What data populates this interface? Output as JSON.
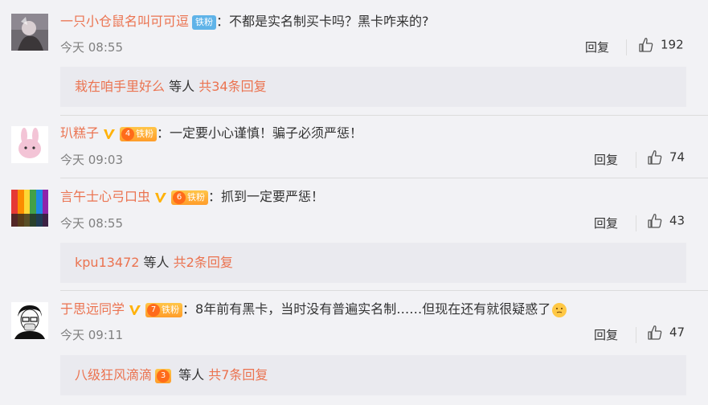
{
  "comments": [
    {
      "username": "一只小仓鼠名叫可可逗",
      "fan_badge": "铁粉",
      "text": "不都是实名制买卡吗？黑卡咋来的?",
      "time": "今天 08:55",
      "reply_label": "回复",
      "likes": "192",
      "thread": {
        "user": "栽在咱手里好么",
        "middle": " 等人 ",
        "count": "共34条回复"
      }
    },
    {
      "username": "玐糕子",
      "fan_badge": "铁粉",
      "fan_level": "4",
      "text": "一定要小心谨慎！骗子必须严惩！",
      "time": "今天 09:03",
      "reply_label": "回复",
      "likes": "74"
    },
    {
      "username": "言午士心弓口虫",
      "fan_badge": "铁粉",
      "fan_level": "6",
      "text": "抓到一定要严惩！",
      "time": "今天 08:55",
      "reply_label": "回复",
      "likes": "43",
      "thread": {
        "user": "kpu13472",
        "middle": " 等人 ",
        "count": "共2条回复"
      }
    },
    {
      "username": "于思远同学",
      "fan_badge": "铁粉",
      "fan_level": "7",
      "text": "8年前有黑卡，当时没有普遍实名制……但现在还有就很疑惑了",
      "time": "今天 09:11",
      "reply_label": "回复",
      "likes": "47",
      "thread": {
        "user": "八级狂风滴滴",
        "user_level": "3",
        "middle": " 等人 ",
        "count": "共7条回复"
      }
    }
  ],
  "colon": "：",
  "colors": {
    "username": "#eb7350",
    "background": "#f2f2f5",
    "reply_box": "#eaeaef"
  }
}
